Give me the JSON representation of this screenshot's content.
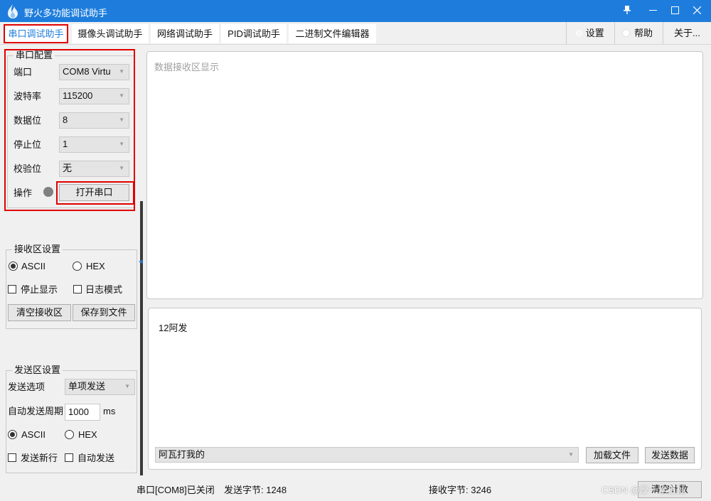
{
  "window": {
    "title": "野火多功能调试助手",
    "controls": {
      "pin": "pin-icon",
      "minimize": "minimize-icon",
      "maximize": "maximize-icon",
      "close": "close-icon"
    }
  },
  "tabs": [
    {
      "label": "串口调试助手",
      "active": true
    },
    {
      "label": "摄像头调试助手"
    },
    {
      "label": "网络调试助手"
    },
    {
      "label": "PID调试助手"
    },
    {
      "label": "二进制文件编辑器"
    }
  ],
  "right_tabs": {
    "settings": "设置",
    "help": "帮助",
    "about": "关于..."
  },
  "serial_config": {
    "title": "串口配置",
    "port_label": "端口",
    "port_value": "COM8 Virtu",
    "baud_label": "波特率",
    "baud_value": "115200",
    "databits_label": "数据位",
    "databits_value": "8",
    "stopbits_label": "停止位",
    "stopbits_value": "1",
    "parity_label": "校验位",
    "parity_value": "无",
    "op_label": "操作",
    "open_button": "打开串口"
  },
  "receive_settings": {
    "title": "接收区设置",
    "ascii": "ASCII",
    "hex": "HEX",
    "selected": "ASCII",
    "stop_display": "停止显示",
    "log_mode": "日志模式",
    "clear_button": "清空接收区",
    "save_button": "保存到文件"
  },
  "send_settings": {
    "title": "发送区设置",
    "option_label": "发送选项",
    "option_value": "单项发送",
    "period_label": "自动发送周期",
    "period_value": "1000",
    "period_unit": "ms",
    "ascii": "ASCII",
    "hex": "HEX",
    "selected": "ASCII",
    "newline": "发送新行",
    "auto_send": "自动发送"
  },
  "receive_area": {
    "placeholder": "数据接收区显示"
  },
  "send_area": {
    "text": "12阿发",
    "history_value": "阿瓦打我的",
    "load_button": "加载文件",
    "send_button": "发送数据"
  },
  "statusbar": {
    "port_status": "串口[COM8]已关闭",
    "sent": "发送字节: 1248",
    "received": "接收字节: 3246",
    "clear_count": "清空计数",
    "watermark": "CSDN @厚一水上仙"
  }
}
